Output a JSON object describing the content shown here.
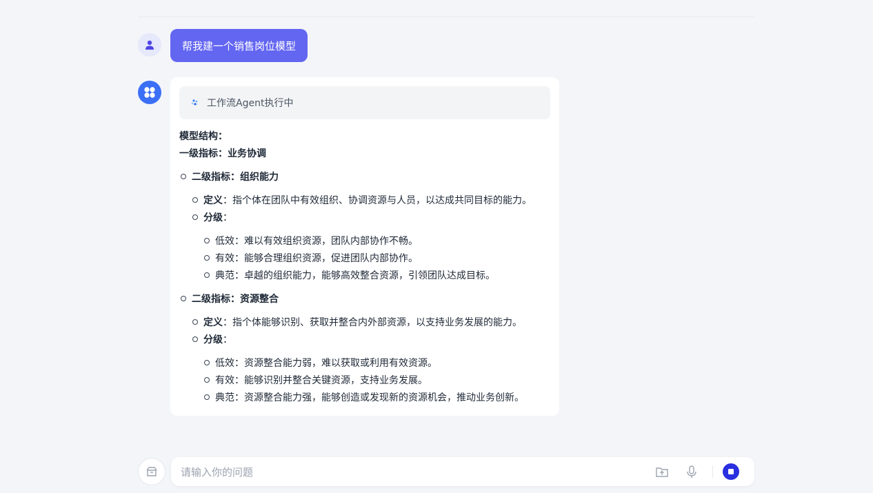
{
  "chat": {
    "user_message": "帮我建一个销售岗位模型",
    "agent_status": "工作流Agent执行中",
    "model": {
      "structure_label": "模型结构",
      "level1_label": "一级指标",
      "level1_value": "业务协调",
      "definition_label": "定义",
      "grading_label": "分级",
      "level2_label": "二级指标",
      "indicators": [
        {
          "name": "组织能力",
          "definition": "指个体在团队中有效组织、协调资源与人员，以达成共同目标的能力。",
          "grades": [
            "低效：难以有效组织资源，团队内部协作不畅。",
            "有效：能够合理组织资源，促进团队内部协作。",
            "典范：卓越的组织能力，能够高效整合资源，引领团队达成目标。"
          ]
        },
        {
          "name": "资源整合",
          "definition": "指个体能够识别、获取并整合内外部资源，以支持业务发展的能力。",
          "grades": [
            "低效：资源整合能力弱，难以获取或利用有效资源。",
            "有效：能够识别并整合关键资源，支持业务发展。",
            "典范：资源整合能力强，能够创造或发现新的资源机会，推动业务创新。"
          ]
        }
      ]
    }
  },
  "input": {
    "placeholder": "请输入你的问题",
    "value": ""
  },
  "colors": {
    "accent": "#6366f1",
    "bot_avatar": "#3b6ff5",
    "stop_button": "#2a2fe0"
  },
  "icons": {
    "user_avatar": "user-icon",
    "bot_avatar": "app-grid-icon",
    "status": "loading-dots-icon",
    "toolbox": "toolbox-icon",
    "upload": "upload-folder-icon",
    "mic": "microphone-icon",
    "stop": "stop-icon"
  }
}
